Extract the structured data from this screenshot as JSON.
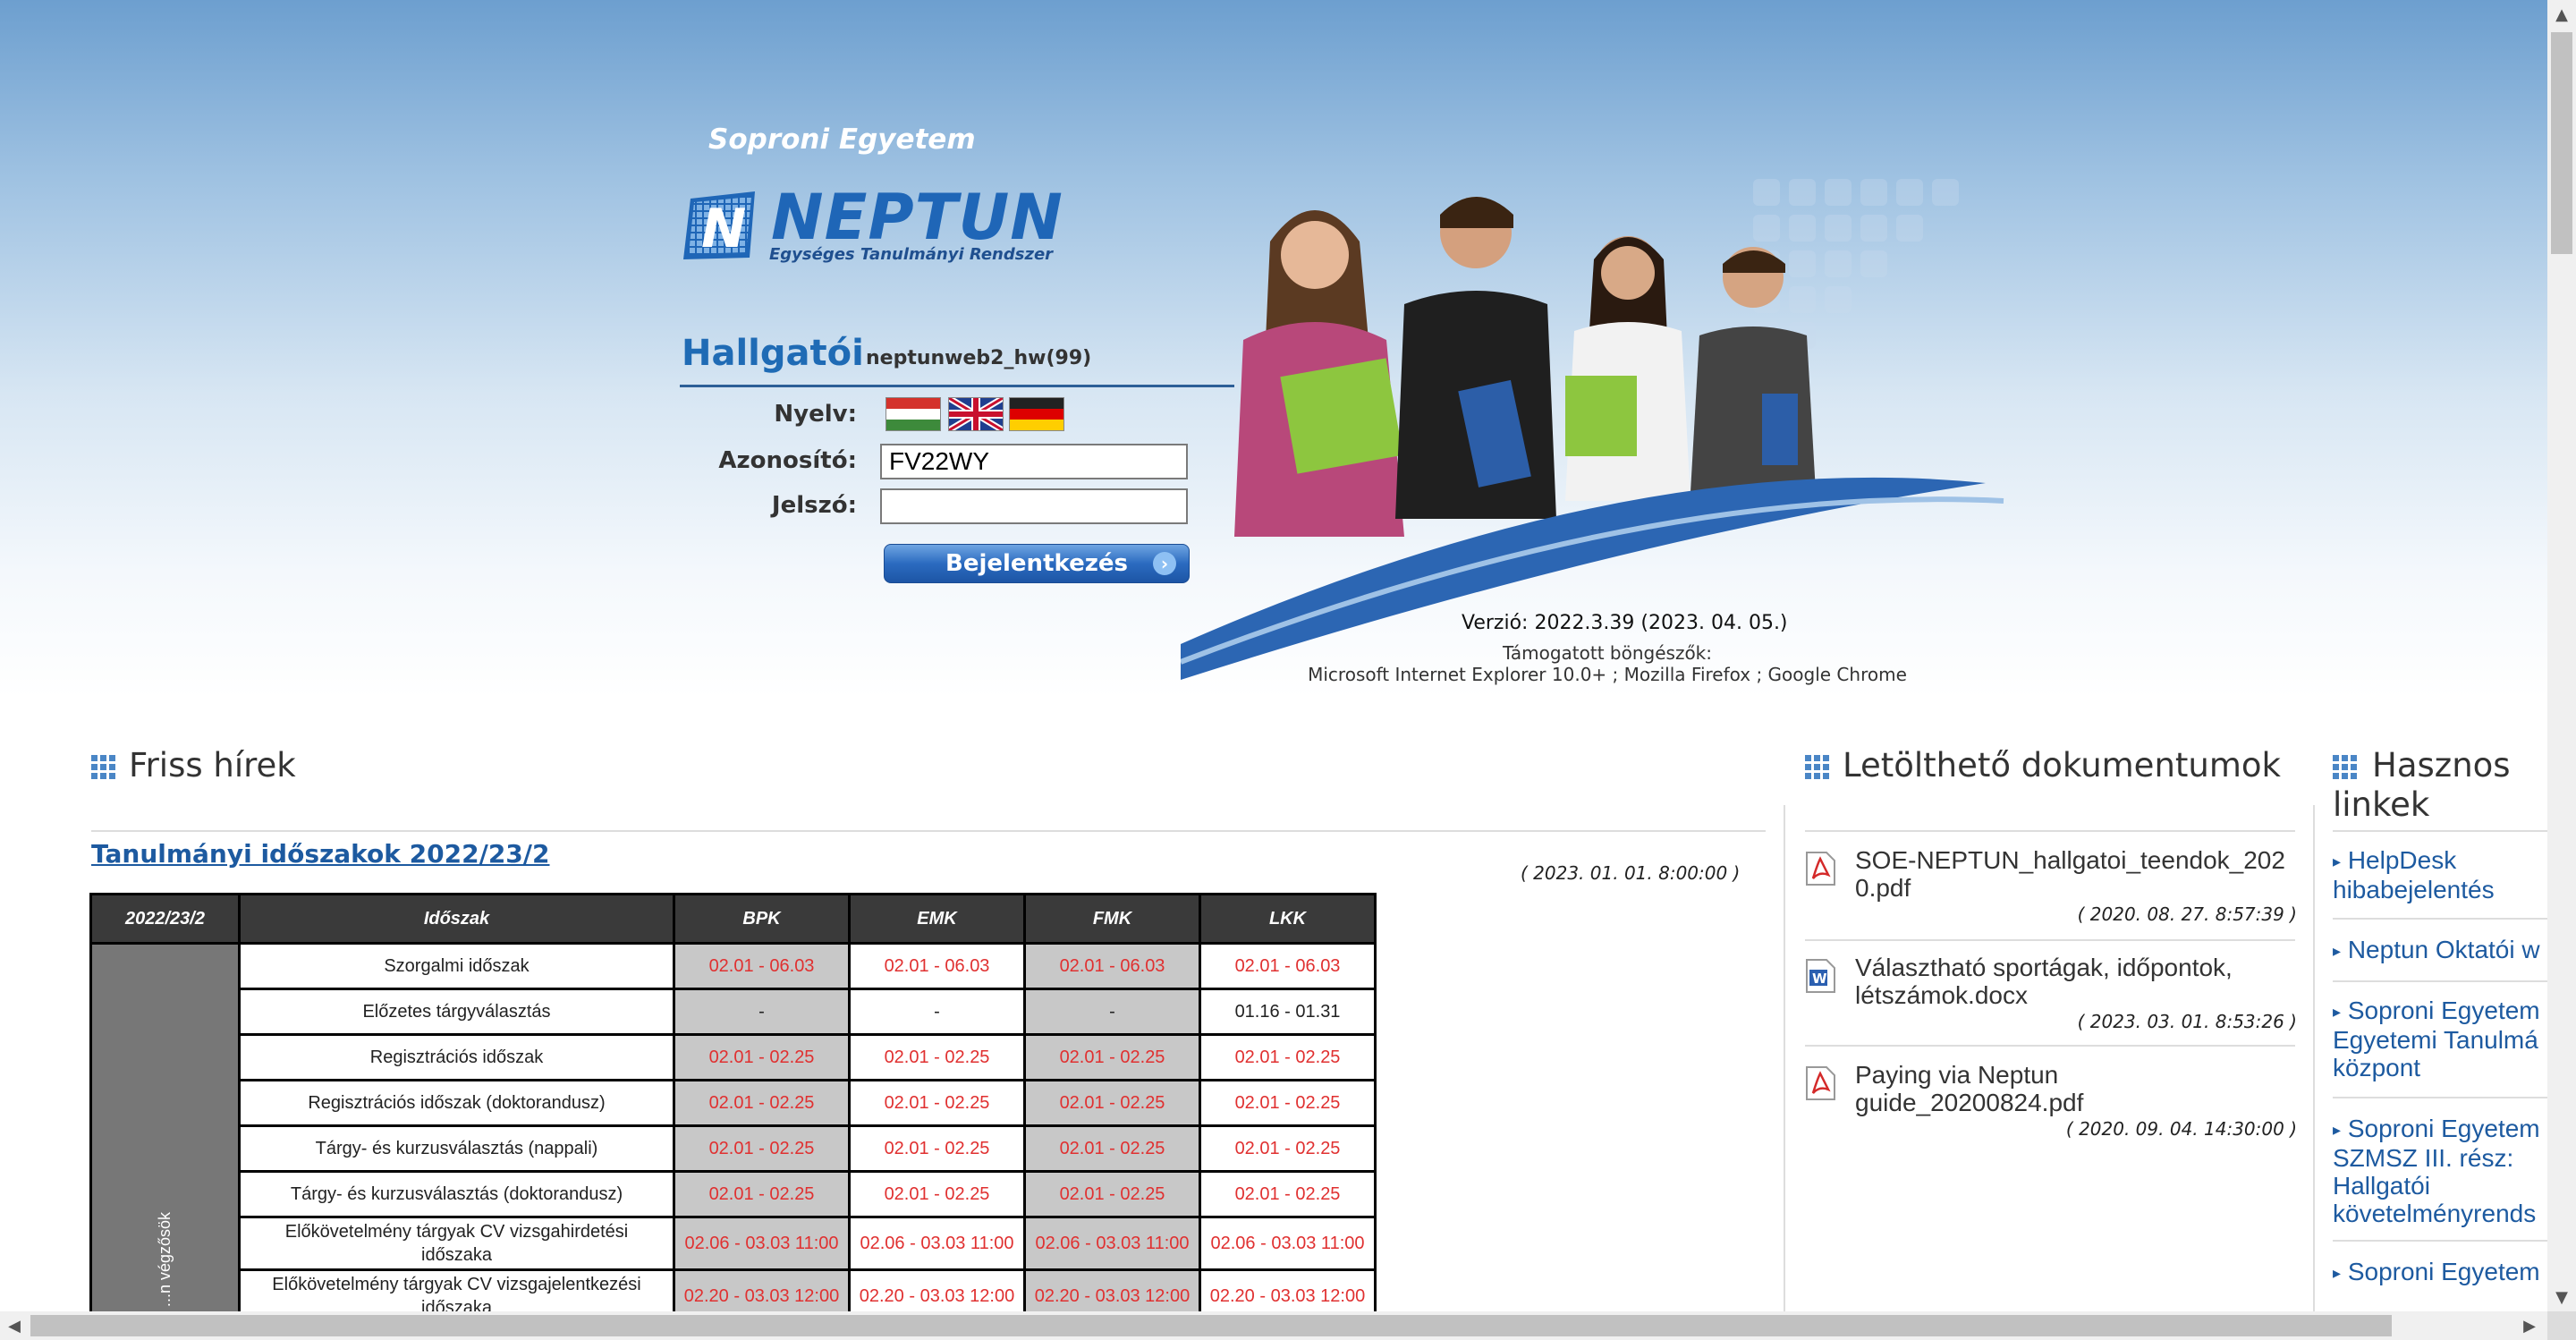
{
  "header": {
    "university": "Soproni Egyetem",
    "logo_word": "NEPTUN",
    "logo_subtitle": "Egységes Tanulmányi Rendszer",
    "portal_title": "Hallgatói",
    "server": "neptunweb2_hw(99)"
  },
  "login": {
    "language_label": "Nyelv:",
    "languages": [
      "hungarian-flag-icon",
      "english-flag-icon",
      "german-flag-icon"
    ],
    "username_label": "Azonosító:",
    "username_value": "FV22WY",
    "password_label": "Jelszó:",
    "password_value": "",
    "login_button": "Bejelentkezés"
  },
  "version": "Verzió: 2022.3.39 (2023. 04. 05.)",
  "supported_title": "Támogatott böngészők:",
  "supported_list": "Microsoft Internet Explorer 10.0+ ; Mozilla Firefox ; Google Chrome",
  "news": {
    "title": "Friss hírek",
    "item_title": "Tanulmányi időszakok 2022/23/2",
    "item_date": "( 2023. 01. 01. 8:00:00 )",
    "table": {
      "headers": [
        "2022/23/2",
        "Időszak",
        "BPK",
        "EMK",
        "FMK",
        "LKK"
      ],
      "side_label": "...n végzősök",
      "rows": [
        {
          "label": "Szorgalmi időszak",
          "cells": [
            "02.01 - 06.03",
            "02.01 - 06.03",
            "02.01 - 06.03",
            "02.01 - 06.03"
          ]
        },
        {
          "label": "Előzetes tárgyválasztás",
          "cells": [
            "-",
            "-",
            "-",
            "01.16 - 01.31"
          ]
        },
        {
          "label": "Regisztrációs időszak",
          "cells": [
            "02.01 - 02.25",
            "02.01 - 02.25",
            "02.01 - 02.25",
            "02.01 - 02.25"
          ]
        },
        {
          "label": "Regisztrációs időszak (doktorandusz)",
          "cells": [
            "02.01 - 02.25",
            "02.01 - 02.25",
            "02.01 - 02.25",
            "02.01 - 02.25"
          ]
        },
        {
          "label": "Tárgy- és kurzusválasztás (nappali)",
          "cells": [
            "02.01 - 02.25",
            "02.01 - 02.25",
            "02.01 - 02.25",
            "02.01 - 02.25"
          ]
        },
        {
          "label": "Tárgy- és kurzusválasztás (doktorandusz)",
          "cells": [
            "02.01 - 02.25",
            "02.01 - 02.25",
            "02.01 - 02.25",
            "02.01 - 02.25"
          ]
        },
        {
          "label": "Előkövetelmény tárgyak CV vizsgahirdetési időszaka",
          "cells": [
            "02.06 - 03.03 11:00",
            "02.06 - 03.03 11:00",
            "02.06 - 03.03 11:00",
            "02.06 - 03.03 11:00"
          ]
        },
        {
          "label": "Előkövetelmény tárgyak CV vizsgajelentkezési időszaka",
          "cells": [
            "02.20 - 03.03 12:00",
            "02.20 - 03.03 12:00",
            "02.20 - 03.03 12:00",
            "02.20 - 03.03 12:00"
          ]
        }
      ]
    }
  },
  "documents": {
    "title": "Letölthető dokumentumok",
    "items": [
      {
        "icon": "pdf-icon",
        "name": "SOE-NEPTUN_hallgatoi_teendok_2020.pdf",
        "date": "( 2020. 08. 27. 8:57:39 )"
      },
      {
        "icon": "word-icon",
        "name": "Választható sportágak, időpontok, létszámok.docx",
        "date": "( 2023. 03. 01. 8:53:26 )"
      },
      {
        "icon": "pdf-icon",
        "name": "Paying via Neptun guide_20200824.pdf",
        "date": "( 2020. 09. 04. 14:30:00 )"
      }
    ]
  },
  "links": {
    "title": "Hasznos linkek",
    "items": [
      "HelpDesk hibabejelentés",
      "Neptun Oktatói w",
      "Soproni Egyetem Egyetemi Tanulmá központ",
      "Soproni Egyetem SZMSZ III. rész: Hallgatói követelményrends",
      "Soproni Egyetem"
    ]
  },
  "colors": {
    "brand": "#1f66b7",
    "accent_red": "#e03030",
    "link": "#1d5aa0"
  }
}
